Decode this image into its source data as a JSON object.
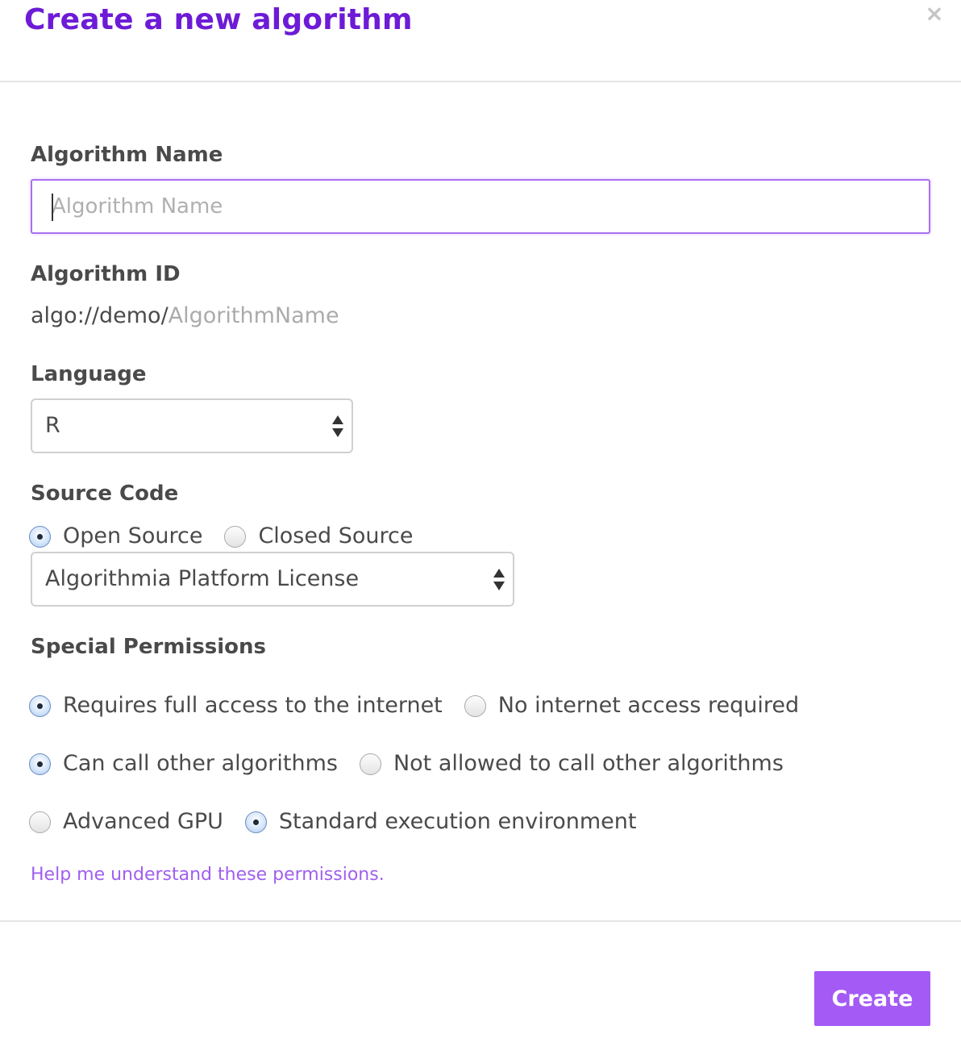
{
  "dialog": {
    "title": "Create a new algorithm",
    "close_icon": "close-icon",
    "close_glyph": "×"
  },
  "name_field": {
    "label": "Algorithm Name",
    "placeholder": "Algorithm Name",
    "value": ""
  },
  "algorithm_id": {
    "label": "Algorithm ID",
    "prefix": "algo://demo/",
    "suffix": "AlgorithmName"
  },
  "language": {
    "label": "Language",
    "selected": "R"
  },
  "source_code": {
    "label": "Source Code",
    "options": [
      {
        "label": "Open Source",
        "checked": true
      },
      {
        "label": "Closed Source",
        "checked": false
      }
    ],
    "license_selected": "Algorithmia Platform License"
  },
  "permissions": {
    "label": "Special Permissions",
    "rows": [
      {
        "options": [
          {
            "label": "Requires full access to the internet",
            "checked": true
          },
          {
            "label": "No internet access required",
            "checked": false
          }
        ]
      },
      {
        "options": [
          {
            "label": "Can call other algorithms",
            "checked": true
          },
          {
            "label": "Not allowed to call other algorithms",
            "checked": false
          }
        ]
      },
      {
        "options": [
          {
            "label": "Advanced GPU",
            "checked": false
          },
          {
            "label": "Standard execution environment",
            "checked": true
          }
        ]
      }
    ],
    "help_link": "Help me understand these permissions."
  },
  "footer": {
    "create_label": "Create"
  },
  "colors": {
    "title": "#6d1bd6",
    "accent": "#a45af5",
    "link": "#a05ff0",
    "input_focus_border": "#a970f0"
  }
}
